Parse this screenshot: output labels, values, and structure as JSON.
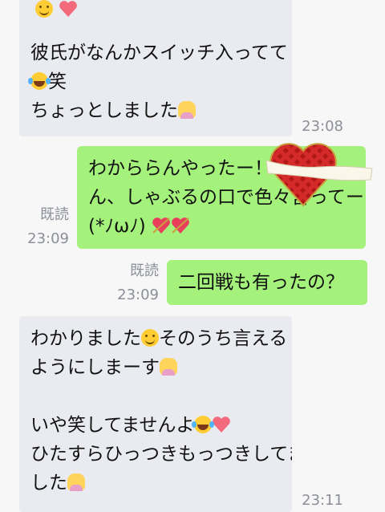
{
  "messages": [
    {
      "id": "m1",
      "side": "in",
      "lines": [
        "彼氏がなんかスイッチ入ってて",
        "笑",
        "ちょっとしました"
      ],
      "time": "23:08"
    },
    {
      "id": "m2",
      "side": "out",
      "lines": [
        "わかららんやったー！ ",
        "ん、しゃぶるの口で色々言ってー",
        "(*ﾉωﾉ)"
      ],
      "read": "既読",
      "time": "23:09"
    },
    {
      "id": "m3",
      "side": "out",
      "lines": [
        "二回戦も有ったの？"
      ],
      "read": "既読",
      "time": "23:09"
    },
    {
      "id": "m4",
      "side": "in",
      "lines": [
        "わかりました",
        "そのうち言える",
        "ようにしまーす",
        "",
        "いや笑してませんよ",
        "ひたすらひっつきもっつきしてま",
        "した"
      ],
      "time": "23:11"
    }
  ],
  "icons": [
    "grinning-icon",
    "heart-icon",
    "laughing-tears-icon",
    "person-raising-hand-icon",
    "smiling-icon",
    "heart-arrow-icon",
    "red-heart-sticker-icon"
  ],
  "colors": {
    "incoming": "#e9ebf0",
    "outgoing": "#a4f27b",
    "meta": "#8b8f98",
    "background": "#f7f7f7"
  }
}
